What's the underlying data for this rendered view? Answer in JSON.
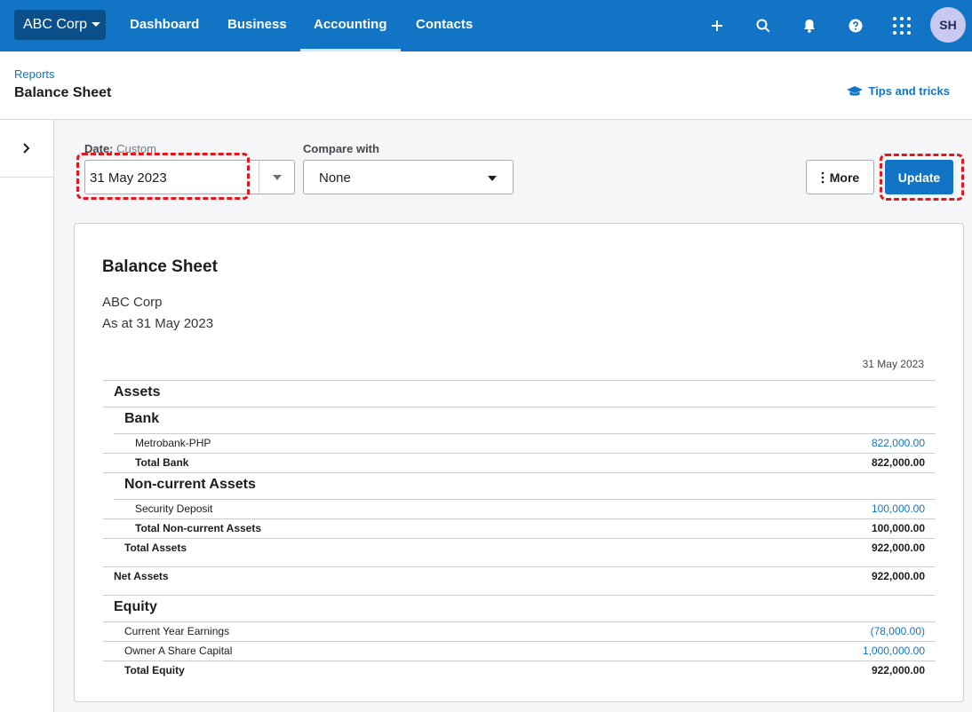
{
  "nav": {
    "org": "ABC Corp",
    "items": [
      "Dashboard",
      "Business",
      "Accounting",
      "Contacts"
    ],
    "active": "Accounting",
    "user_initials": "SH"
  },
  "header": {
    "breadcrumb": "Reports",
    "title": "Balance Sheet",
    "tips": "Tips and tricks"
  },
  "controls": {
    "date_label": "Date:",
    "date_mode": "Custom",
    "date_value": "31 May 2023",
    "compare_label": "Compare with",
    "compare_value": "None",
    "more_label": "More",
    "update_label": "Update"
  },
  "report": {
    "title": "Balance Sheet",
    "company": "ABC Corp",
    "as_at": "As at 31 May 2023",
    "column": "31 May 2023",
    "rows": [
      {
        "label": "Assets",
        "kind": "sec",
        "indent": 1,
        "amount": ""
      },
      {
        "label": "Bank",
        "kind": "sec",
        "indent": 2,
        "amount": ""
      },
      {
        "label": "Metrobank-PHP",
        "kind": "item",
        "indent": 3,
        "amount": "822,000.00"
      },
      {
        "label": "Total Bank",
        "kind": "total",
        "indent": 3,
        "amount": "822,000.00"
      },
      {
        "label": "Non-current Assets",
        "kind": "sec",
        "indent": 2,
        "amount": ""
      },
      {
        "label": "Security Deposit",
        "kind": "item",
        "indent": 3,
        "amount": "100,000.00"
      },
      {
        "label": "Total Non-current Assets",
        "kind": "total",
        "indent": 3,
        "amount": "100,000.00"
      },
      {
        "label": "Total Assets",
        "kind": "total",
        "indent": 2,
        "amount": "922,000.00"
      },
      {
        "label": "Net Assets",
        "kind": "total",
        "indent": 1,
        "amount": "922,000.00"
      },
      {
        "label": "Equity",
        "kind": "sec",
        "indent": 1,
        "amount": ""
      },
      {
        "label": "Current Year Earnings",
        "kind": "item",
        "indent": 2,
        "amount": "(78,000.00)"
      },
      {
        "label": "Owner A Share Capital",
        "kind": "item",
        "indent": 2,
        "amount": "1,000,000.00"
      },
      {
        "label": "Total Equity",
        "kind": "total",
        "indent": 2,
        "amount": "922,000.00"
      }
    ]
  },
  "colors": {
    "brand": "#1274c4",
    "highlight": "#e8141c"
  }
}
